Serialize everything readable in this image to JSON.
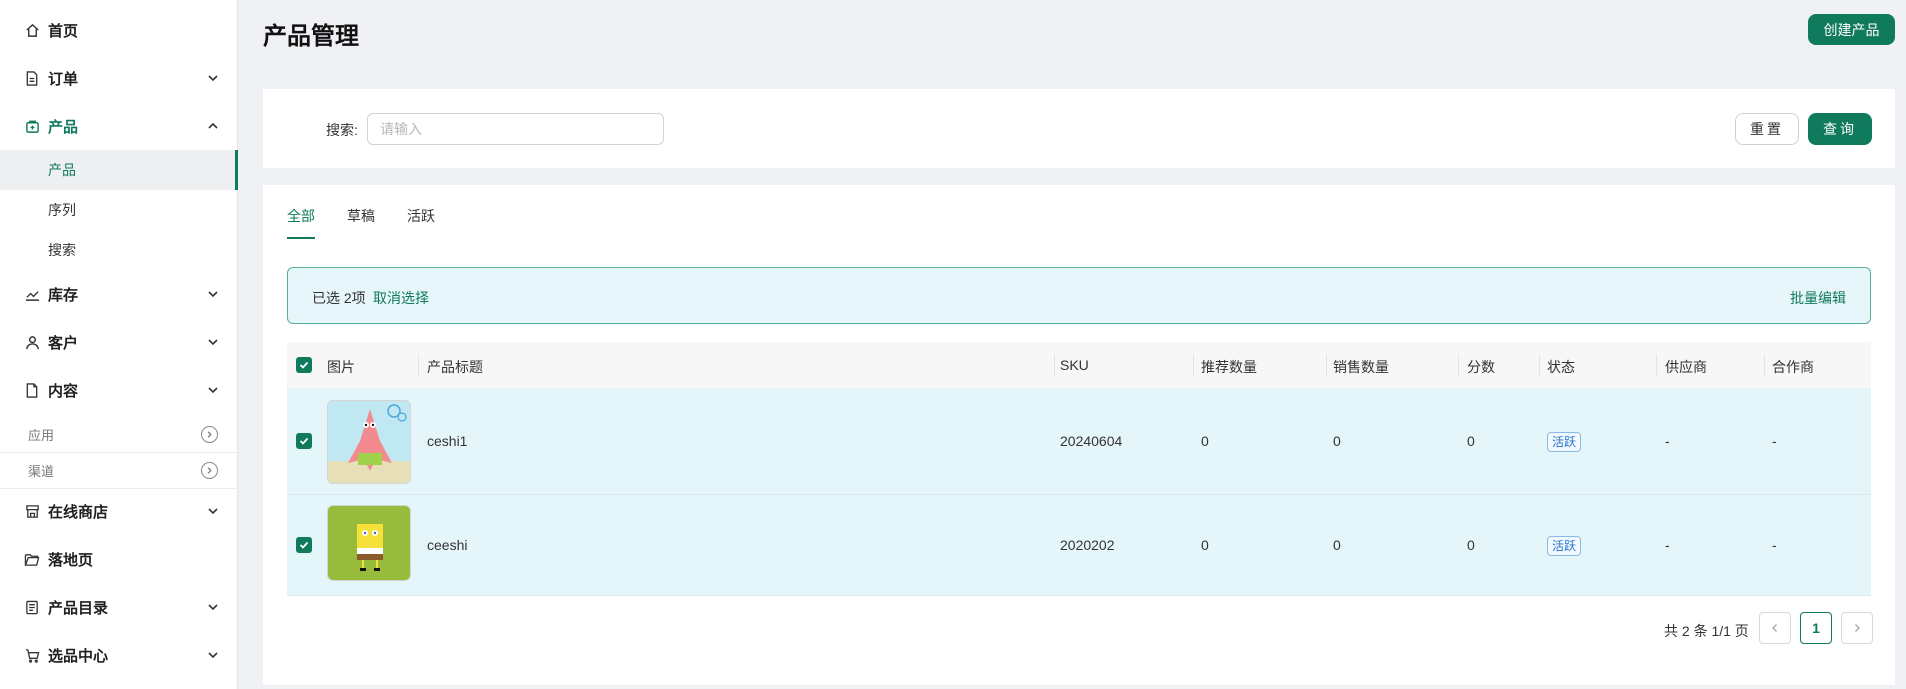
{
  "page": {
    "title": "产品管理",
    "create_button": "创建产品"
  },
  "sidebar": {
    "home": "首页",
    "orders": "订单",
    "products": "产品",
    "products_sub": [
      "产品",
      "序列",
      "搜索"
    ],
    "inventory": "库存",
    "customers": "客户",
    "content": "内容",
    "section_apps": "应用",
    "section_channels": "渠道",
    "online_store": "在线商店",
    "landing_page": "落地页",
    "catalog": "产品目录",
    "selection_center": "选品中心"
  },
  "search": {
    "label": "搜索:",
    "placeholder": "请输入",
    "value": "",
    "reset": "重置",
    "query": "查询"
  },
  "tabs": [
    "全部",
    "草稿",
    "活跃"
  ],
  "selection": {
    "text": "已选 2项",
    "cancel": "取消选择",
    "bulk_edit": "批量编辑"
  },
  "table": {
    "headers": [
      "图片",
      "产品标题",
      "SKU",
      "推荐数量",
      "销售数量",
      "分数",
      "状态",
      "供应商",
      "合作商"
    ],
    "rows": [
      {
        "title": "ceshi1",
        "sku": "20240604",
        "recommended": "0",
        "sales": "0",
        "score": "0",
        "status": "活跃",
        "supplier": "-",
        "partner": "-",
        "checked": true
      },
      {
        "title": "ceeshi",
        "sku": "2020202",
        "recommended": "0",
        "sales": "0",
        "score": "0",
        "status": "活跃",
        "supplier": "-",
        "partner": "-",
        "checked": true
      }
    ]
  },
  "pagination": {
    "total_text": "共 2 条 1/1 页",
    "current_page": "1"
  },
  "colors": {
    "accent": "#0f7a5c",
    "selected_row": "#e5f6fb",
    "badge_blue": "#2a76c6"
  }
}
